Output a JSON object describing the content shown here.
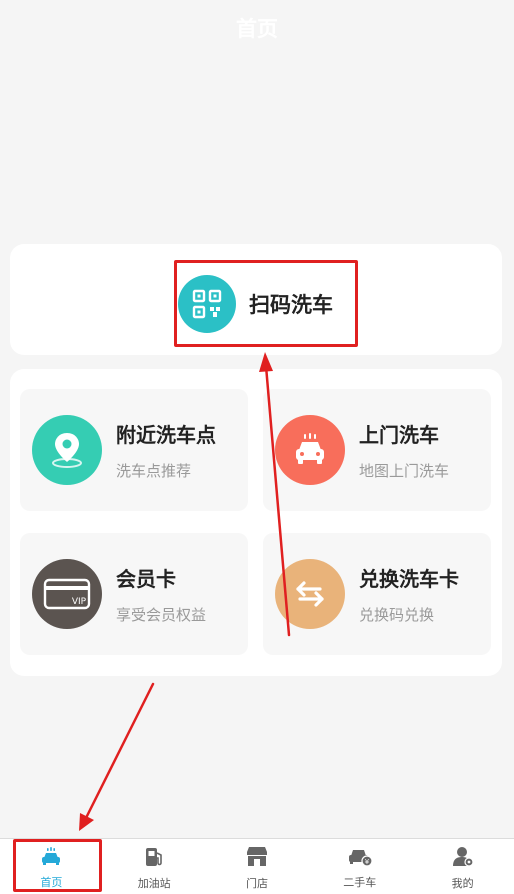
{
  "header": {
    "title": "首页"
  },
  "scan": {
    "label": "扫码洗车",
    "icon": "qr-code-icon",
    "color": "#2bc0c6"
  },
  "tiles": [
    {
      "title": "附近洗车点",
      "subtitle": "洗车点推荐",
      "icon": "location-pin-icon",
      "color": "#35cdb3"
    },
    {
      "title": "上门洗车",
      "subtitle": "地图上门洗车",
      "icon": "car-wash-icon",
      "color": "#f86e5b"
    },
    {
      "title": "会员卡",
      "subtitle": "享受会员权益",
      "icon": "vip-card-icon",
      "color": "#5b5450"
    },
    {
      "title": "兑换洗车卡",
      "subtitle": "兑换码兑换",
      "icon": "exchange-icon",
      "color": "#e9b37a"
    }
  ],
  "tabbar": {
    "active_color": "#25a9d8",
    "items": [
      {
        "label": "首页",
        "icon": "car-wash-home-icon",
        "active": true
      },
      {
        "label": "加油站",
        "icon": "gas-pump-icon"
      },
      {
        "label": "门店",
        "icon": "store-icon"
      },
      {
        "label": "二手车",
        "icon": "used-car-icon"
      },
      {
        "label": "我的",
        "icon": "user-icon"
      }
    ]
  },
  "annotation_color": "#e02020"
}
